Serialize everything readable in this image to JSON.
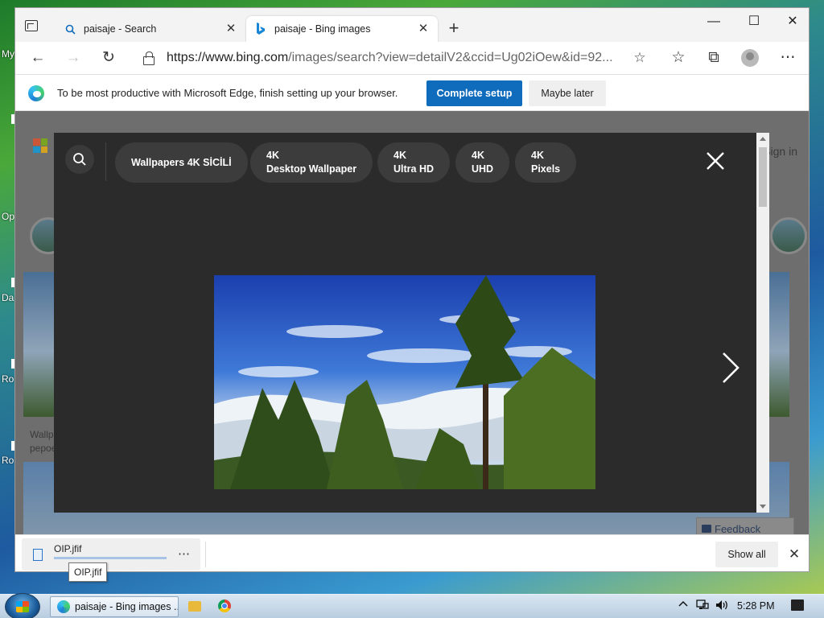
{
  "desktop": {
    "labels": [
      "My",
      "Op",
      "Da",
      "Ro",
      "Ro"
    ]
  },
  "browser": {
    "tabs": [
      {
        "title": "paisaje - Search",
        "icon": "search-icon",
        "active": false
      },
      {
        "title": "paisaje - Bing images",
        "icon": "bing-icon",
        "active": true
      }
    ],
    "new_tab_label": "+",
    "window_controls": {
      "minimize": "—",
      "maximize": "☐",
      "close": "✕"
    },
    "toolbar": {
      "back": "←",
      "forward": "→",
      "refresh": "↻",
      "url_host": "https://www.bing.com",
      "url_path": "/images/search?view=detailV2&ccid=Ug02iOew&id=92...",
      "favorite_icon": "☆",
      "favorites_icon": "☆",
      "collections_icon": "⧉",
      "menu": "⋯"
    },
    "infobar": {
      "message": "To be most productive with Microsoft Edge, finish setting up your browser.",
      "primary_button": "Complete setup",
      "secondary_button": "Maybe later"
    }
  },
  "page": {
    "signin_label": "Sign in",
    "caption_line1": "Wallp",
    "caption_line2": "pepoe",
    "feedback_label": "Feedback"
  },
  "overlay": {
    "chips": [
      {
        "line1": "Wallpapers 4K SİCİLİ",
        "line2": ""
      },
      {
        "line1": "4K",
        "line2": "Desktop Wallpaper"
      },
      {
        "line1": "4K",
        "line2": "Ultra HD"
      },
      {
        "line1": "4K",
        "line2": "UHD"
      },
      {
        "line1": "4K",
        "line2": "Pixels"
      }
    ]
  },
  "downloads": {
    "file_name": "OIP.jfif",
    "more": "⋯",
    "show_all": "Show all",
    "close": "✕",
    "tooltip": "OIP.jfif"
  },
  "taskbar": {
    "task_label": "paisaje - Bing images ...",
    "clock": "5:28 PM"
  },
  "colors": {
    "accent": "#0f6cbd",
    "overlay_bg": "#2b2b2b",
    "chip_bg": "#3c3c3c"
  }
}
